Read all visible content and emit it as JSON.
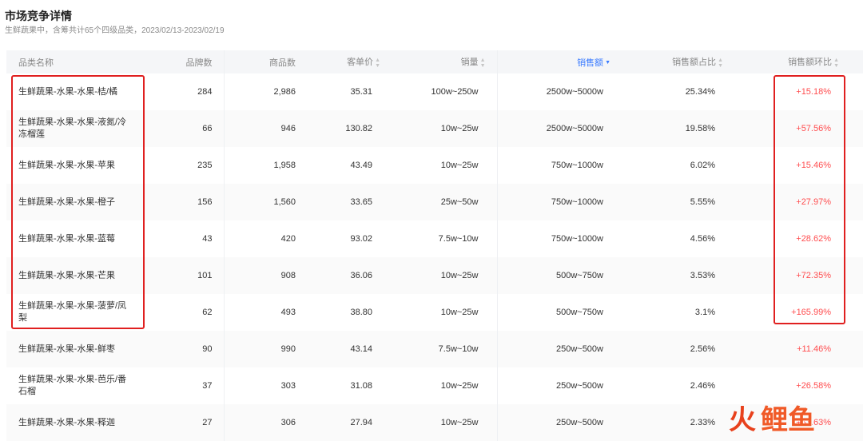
{
  "page": {
    "title": "市场竞争详情",
    "subtitle": "生鲜蔬果中，含筹共计65个四级品类，2023/02/13-2023/02/19"
  },
  "table": {
    "headers": {
      "name": "品类名称",
      "brands": "品牌数",
      "products": "商品数",
      "unit_price": "客单价",
      "volume": "销量",
      "sales": "销售额",
      "share": "销售额占比",
      "growth": "销售额环比"
    },
    "rows": [
      {
        "name": "生鲜蔬果-水果-水果-桔/橘",
        "brands": "284",
        "products": "2,986",
        "unit_price": "35.31",
        "volume": "100w~250w",
        "sales": "2500w~5000w",
        "share": "25.34%",
        "growth": "+15.18%"
      },
      {
        "name": "生鲜蔬果-水果-水果-液氮/冷冻榴莲",
        "brands": "66",
        "products": "946",
        "unit_price": "130.82",
        "volume": "10w~25w",
        "sales": "2500w~5000w",
        "share": "19.58%",
        "growth": "+57.56%"
      },
      {
        "name": "生鲜蔬果-水果-水果-苹果",
        "brands": "235",
        "products": "1,958",
        "unit_price": "43.49",
        "volume": "10w~25w",
        "sales": "750w~1000w",
        "share": "6.02%",
        "growth": "+15.46%"
      },
      {
        "name": "生鲜蔬果-水果-水果-橙子",
        "brands": "156",
        "products": "1,560",
        "unit_price": "33.65",
        "volume": "25w~50w",
        "sales": "750w~1000w",
        "share": "5.55%",
        "growth": "+27.97%"
      },
      {
        "name": "生鲜蔬果-水果-水果-蓝莓",
        "brands": "43",
        "products": "420",
        "unit_price": "93.02",
        "volume": "7.5w~10w",
        "sales": "750w~1000w",
        "share": "4.56%",
        "growth": "+28.62%"
      },
      {
        "name": "生鲜蔬果-水果-水果-芒果",
        "brands": "101",
        "products": "908",
        "unit_price": "36.06",
        "volume": "10w~25w",
        "sales": "500w~750w",
        "share": "3.53%",
        "growth": "+72.35%"
      },
      {
        "name": "生鲜蔬果-水果-水果-菠萝/凤梨",
        "brands": "62",
        "products": "493",
        "unit_price": "38.80",
        "volume": "10w~25w",
        "sales": "500w~750w",
        "share": "3.1%",
        "growth": "+165.99%"
      },
      {
        "name": "生鲜蔬果-水果-水果-鲜枣",
        "brands": "90",
        "products": "990",
        "unit_price": "43.14",
        "volume": "7.5w~10w",
        "sales": "250w~500w",
        "share": "2.56%",
        "growth": "+11.46%"
      },
      {
        "name": "生鲜蔬果-水果-水果-芭乐/番石榴",
        "brands": "37",
        "products": "303",
        "unit_price": "31.08",
        "volume": "10w~25w",
        "sales": "250w~500w",
        "share": "2.46%",
        "growth": "+26.58%"
      },
      {
        "name": "生鲜蔬果-水果-水果-释迦",
        "brands": "27",
        "products": "306",
        "unit_price": "27.94",
        "volume": "10w~25w",
        "sales": "250w~500w",
        "share": "2.33%",
        "growth": "+83.63%"
      }
    ]
  },
  "sort_icons": {
    "neutral": "sort-both-icon",
    "active": "sort-desc-icon"
  },
  "colors": {
    "accent": "#3a7bff",
    "growth_text": "#ff4d4f",
    "highlight_box": "#e02020",
    "header_bg": "#f5f6f8",
    "logo": "#f05a28"
  },
  "watermark_logo": {
    "glyph": "火",
    "text": "鲤鱼"
  }
}
